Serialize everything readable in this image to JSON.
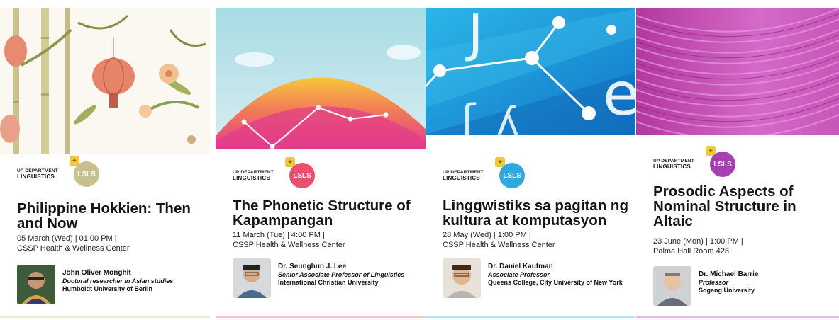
{
  "department": {
    "top": "UP DEPARTMENT",
    "bottom": "LINGUISTICS",
    "badge": "LSLS"
  },
  "cards": [
    {
      "title": "Philippine Hokkien: Then and Now",
      "date_line": "05 March (Wed) | 01:00 PM |",
      "venue": "CSSP Health & Wellness Center",
      "speaker_name": "John Oliver Monghit",
      "speaker_role": "Doctoral researcher in Asian studies",
      "speaker_inst": "Humboldt University of Berlin",
      "badge_color": "#c7c08c"
    },
    {
      "title": "The Phonetic Structure of Kapampangan",
      "date_line": "11 March (Tue) | 4:00 PM |",
      "venue": "CSSP Health & Wellness Center",
      "speaker_name": "Dr. Seunghun J. Lee",
      "speaker_role": "Senior Associate Professor of Linguistics",
      "speaker_inst": "International Christian University",
      "badge_color": "#ea4f6e"
    },
    {
      "title": "Linggwistiks sa pagitan ng kultura at komputasyon",
      "date_line": "28 May (Wed) | 1:00 PM |",
      "venue": "CSSP Health & Wellness Center",
      "speaker_name": "Dr. Daniel Kaufman",
      "speaker_role": "Associate Professor",
      "speaker_inst": "Queens College, City University of New York",
      "badge_color": "#2fa8e0"
    },
    {
      "title": "Prosodic Aspects of Nominal Structure in Altaic",
      "date_line": "23 June (Mon) | 1:00 PM |",
      "venue": "Palma Hall Room 428",
      "speaker_name": "Dr. Michael Barrie",
      "speaker_role": "Professor",
      "speaker_inst": "Sogang University",
      "badge_color": "#a83fb0"
    }
  ]
}
